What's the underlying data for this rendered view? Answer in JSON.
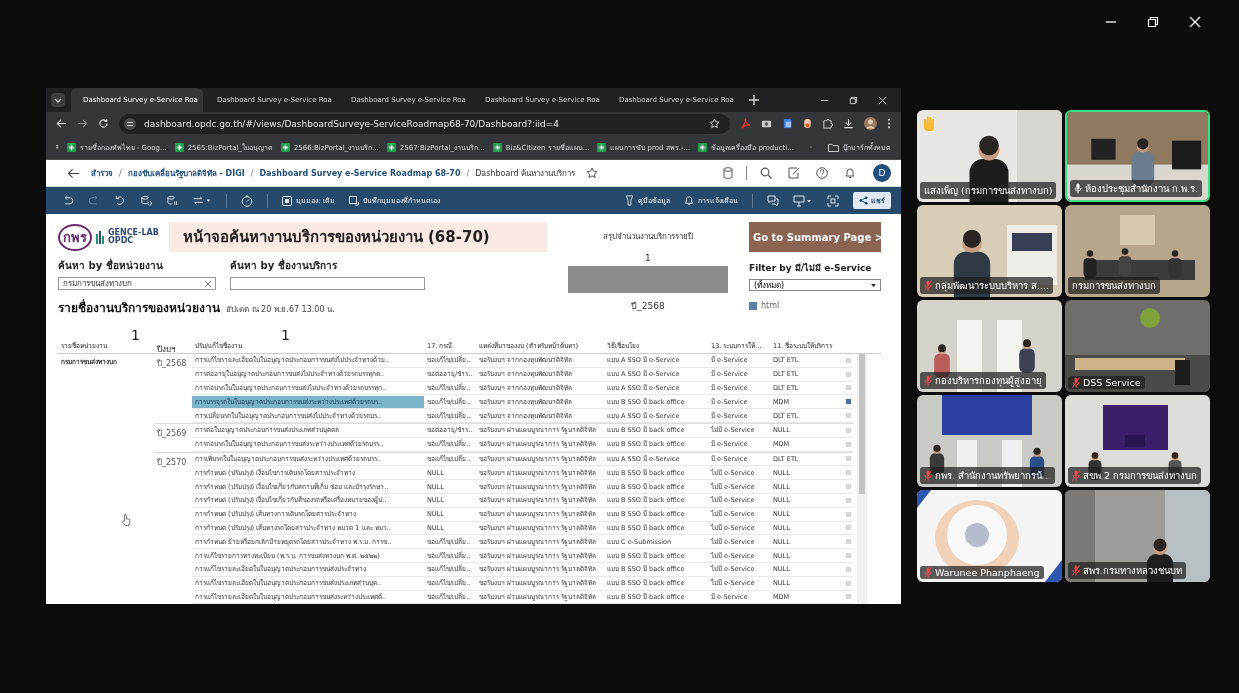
{
  "browser": {
    "tabs": [
      {
        "title": "Dashboard Survey e-Service Roa",
        "selected": true
      },
      {
        "title": "Dashboard Survey e-Service Roa",
        "selected": false
      },
      {
        "title": "Dashboard Survey e-Service Roa",
        "selected": false
      },
      {
        "title": "Dashboard Survey e-Service Roa",
        "selected": false
      },
      {
        "title": "Dashboard Survey e-Service Roa",
        "selected": false
      }
    ],
    "url": "dashboard.opdc.go.th/#/views/DashboardSurveye-ServiceRoadmap68-70/Dashboard?:iid=4",
    "bookmarks": [
      "รายชื่อกองทัพไทย - Goog...",
      "2565:BizPortal_ใบอนุญาต",
      "2566:BizPortal_งานบริก...",
      "2567:BizPortal_งานบริก...",
      "Biz&Citizen รายชื่อแผน...",
      "แผนการขับ prod สพร.-...",
      "ข้อมูลเครื่องมือ producti..."
    ],
    "bookmarks_folder": "บุ๊กมาร์กทั้งหมด"
  },
  "breadcrumb": {
    "separator": "/",
    "items": [
      "สำรวจ",
      "กองขับเคลื่อนรัฐบาลดิจิทัล - DIGI",
      "Dashboard Survey e-Service Roadmap 68-70",
      "Dashboard ค้นหางานบริการ"
    ]
  },
  "user_initial": "D",
  "toolbar": {
    "view": "มุมมอง: เดิม",
    "save_view": "บันทึกมุมมองที่กำหนดเอง",
    "data_guide": "คู่มือข้อมูล",
    "alerts": "การแจ้งเตือน",
    "share": "แชร์"
  },
  "dashboard": {
    "logo_mark": "กพร",
    "logo_lab": "GENCE-LAB",
    "logo_org": "OPDC",
    "title": "หน้าจอค้นหางานบริการของหน่วยงาน (68-70)",
    "agency_search": {
      "label": "ค้นหา by ชื่อหน่วยงาน",
      "value": "กรมการขนส่งทางบก"
    },
    "service_search": {
      "label": "ค้นหา by ชื่องานบริการ"
    },
    "list_title": "รายชื่องานบริการของหน่วยงาน",
    "updated": "อัปเดต ณ 20 พ.ย.67  13.00 น.",
    "summary": {
      "title": "สรุปจำนวนงานบริการรายปี",
      "count": "1",
      "year": "ปี_2568"
    },
    "summary_button": "Go to Summary Page >",
    "filter": {
      "label": "Filter by มี/ไม่มี e-Service",
      "value": "(ทั้งหมด)",
      "legend": [
        "html"
      ]
    },
    "table": {
      "columns": [
        {
          "label": "รายชื่อหน่วยงาน",
          "mark": "1"
        },
        {
          "label": "ปีงบฯ"
        },
        {
          "label": "ปรับ/แก้ไขชื่องาน",
          "mark": "1"
        },
        {
          "label": "17. กรณี"
        },
        {
          "label": "แหล่งที่มาของงบ (สำหรับหน้าค้นหา)"
        },
        {
          "label": "วิธีเชื่อมโยง"
        },
        {
          "label": "13. ระบบการให้..."
        },
        {
          "label": "11. ชื่อระบบให้บริการ"
        }
      ],
      "agencies": [
        {
          "name": "กรมการขนส่งทางบก",
          "years": [
            {
              "year": "ปี_2568",
              "services": [
                {
                  "name": "การแก้ไขรายละเอียดในใบอนุญาตประกอบการขนส่งไม่ประจำทางด้วย..",
                  "case": "ขอแก้ไข/เปลี่ย..",
                  "source": "ขอรับงบฯ จากกองทุนพัฒนาดิจิทัล",
                  "method": "แบบ A SSO มี e-Service",
                  "eservice": "มี e-Service",
                  "system": "DLT ETL",
                  "selected": false
                },
                {
                  "name": "การต่ออายุใบอนุญาตประกอบการขนส่งไม่ประจำทางด้วยรถบรรทุกค..",
                  "case": "ขอต่ออายุ/ชำร..",
                  "source": "ขอรับงบฯ จากกองทุนพัฒนาดิจิทัล",
                  "method": "แบบ A SSO มี e-Service",
                  "eservice": "มี e-Service",
                  "system": "DLT ETL",
                  "selected": false
                },
                {
                  "name": "การถอนรถในใบอนุญาตประกอบการขนส่งไม่ประจำทางด้วยรถบรรทุก..",
                  "case": "ขอแก้ไข/เปลี่ย..",
                  "source": "ขอรับงบฯ จากกองทุนพัฒนาดิจิทัล",
                  "method": "แบบ A SSO มี e-Service",
                  "eservice": "มี e-Service",
                  "system": "DLT ETL",
                  "selected": false
                },
                {
                  "name": "การบรรจุรถในใบอนุญาตประกอบการขนส่งระหว่างประเทศด้วยรถบร..",
                  "case": "ขอแก้ไข/เปลี่ย..",
                  "source": "ขอรับงบฯ จากกองทุนพัฒนาดิจิทัล",
                  "method": "แบบ B SSO มี back office",
                  "eservice": "มี e-Service",
                  "system": "MDM",
                  "selected": true
                },
                {
                  "name": "การเปลี่ยนรถในใบอนุญาตประกอบการขนส่งไม่ประจำทางด้วยรถบร..",
                  "case": "ขอแก้ไข/เปลี่ย..",
                  "source": "ขอรับงบฯ จากกองทุนพัฒนาดิจิทัล",
                  "method": "แบบ A SSO มี e-Service",
                  "eservice": "มี e-Service",
                  "system": "DLT ETL",
                  "selected": false
                }
              ]
            },
            {
              "year": "ปี_2569",
              "services": [
                {
                  "name": "การต่อใบอนุญาตประกอบการขนส่งประเภทส่วนบุคคล",
                  "case": "ขอต่ออายุ/ชำร..",
                  "source": "ขอรับงบฯ ผ่านแผนบูรณาการ รัฐบาลดิจิทัล",
                  "method": "แบบ B SSO มี back office",
                  "eservice": "ไม่มี e-Service",
                  "system": "NULL",
                  "selected": false
                },
                {
                  "name": "การถอนรถในใบอนุญาตประกอบการขนส่งระหว่างประเทศด้วยรถบรร..",
                  "case": "ขอแก้ไข/เปลี่ย..",
                  "source": "ขอรับงบฯ ผ่านแผนบูรณาการ รัฐบาลดิจิทัล",
                  "method": "แบบ B SSO มี back office",
                  "eservice": "มี e-Service",
                  "system": "MDM",
                  "selected": false
                }
              ]
            },
            {
              "year": "ปี_2570",
              "services": [
                {
                  "name": "การเพิ่มรถในใบอนุญาตประกอบการขนส่งระหว่างประเทศด้วยรถบรร..",
                  "case": "ขอแก้ไข/เปลี่ย..",
                  "source": "ขอรับงบฯ ผ่านแผนบูรณาการ รัฐบาลดิจิทัล",
                  "method": "แบบ A SSO มี e-Service",
                  "eservice": "มี e-Service",
                  "system": "DLT ETL",
                  "selected": false
                },
                {
                  "name": "การกำหนด (ปรับปรุง) เงื่อนไขการเดินรถโดยสารประจำทาง",
                  "case": "NULL",
                  "source": "ขอรับงบฯ ผ่านแผนบูรณาการ รัฐบาลดิจิทัล",
                  "method": "แบบ B SSO มี back office",
                  "eservice": "ไม่มี e-Service",
                  "system": "NULL",
                  "selected": false
                },
                {
                  "name": "การกำหนด (ปรับปรุง) เงื่อนไขเกี่ยวกับสถานที่เก็บ ซ่อม และบำรุงรักษา..",
                  "case": "NULL",
                  "source": "ขอรับงบฯ ผ่านแผนบูรณาการ รัฐบาลดิจิทัล",
                  "method": "แบบ B SSO มี back office",
                  "eservice": "ไม่มี e-Service",
                  "system": "NULL",
                  "selected": false
                },
                {
                  "name": "การกำหนด (ปรับปรุง) เงื่อนไขเกี่ยวกับสีของรถหรือเครื่องหมายของผู้ป..",
                  "case": "NULL",
                  "source": "ขอรับงบฯ ผ่านแผนบูรณาการ รัฐบาลดิจิทัล",
                  "method": "แบบ B SSO มี back office",
                  "eservice": "ไม่มี e-Service",
                  "system": "NULL",
                  "selected": false
                },
                {
                  "name": "การกำหนด (ปรับปรุง) เส้นทางการเดินรถโดยสารประจำทาง",
                  "case": "NULL",
                  "source": "ขอรับงบฯ ผ่านแผนบูรณาการ รัฐบาลดิจิทัล",
                  "method": "แบบ B SSO มี back office",
                  "eservice": "ไม่มี e-Service",
                  "system": "NULL",
                  "selected": false
                },
                {
                  "name": "การกำหนด (ปรับปรุง) เส้นทางรถโดยสารประจำทาง หมวด 1 และ หมว..",
                  "case": "NULL",
                  "source": "ขอรับงบฯ ผ่านแผนบูรณาการ รัฐบาลดิจิทัล",
                  "method": "แบบ B SSO มี back office",
                  "eservice": "ไม่มี e-Service",
                  "system": "NULL",
                  "selected": false
                },
                {
                  "name": "การกำหนด ย้ายหรือยกเลิกป้ายหยุดรถโดยสารประจำทาง พ.ร.บ. การข..",
                  "case": "ขอแก้ไข/เปลี่ย..",
                  "source": "ขอรับงบฯ ผ่านแผนบูรณาการ รัฐบาลดิจิทัล",
                  "method": "แบบ C e-Submission",
                  "eservice": "ไม่มี e-Service",
                  "system": "NULL",
                  "selected": false
                },
                {
                  "name": "การแก้ไขรายการทางทะเบียน (พ.ร.บ. การขนส่งทางบก พ.ศ. ๒๕๒๒)",
                  "case": "ขอแก้ไข/เปลี่ย..",
                  "source": "ขอรับงบฯ ผ่านแผนบูรณาการ รัฐบาลดิจิทัล",
                  "method": "แบบ B SSO มี back office",
                  "eservice": "ไม่มี e-Service",
                  "system": "NULL",
                  "selected": false
                },
                {
                  "name": "การแก้ไขรายละเอียดในใบอนุญาตประกอบการขนส่งประจำทาง",
                  "case": "ขอแก้ไข/เปลี่ย..",
                  "source": "ขอรับงบฯ ผ่านแผนบูรณาการ รัฐบาลดิจิทัล",
                  "method": "แบบ B SSO มี back office",
                  "eservice": "ไม่มี e-Service",
                  "system": "NULL",
                  "selected": false
                },
                {
                  "name": "การแก้ไขรายละเอียดในใบอนุญาตประกอบการขนส่งประเภทส่วนบุค..",
                  "case": "ขอแก้ไข/เปลี่ย..",
                  "source": "ขอรับงบฯ ผ่านแผนบูรณาการ รัฐบาลดิจิทัล",
                  "method": "แบบ B SSO มี back office",
                  "eservice": "ไม่มี e-Service",
                  "system": "NULL",
                  "selected": false
                },
                {
                  "name": "การแก้ไขรายละเอียดในใบอนุญาตประกอบการขนส่งระหว่างประเทศด้..",
                  "case": "ขอแก้ไข/เปลี่ย..",
                  "source": "ขอรับงบฯ ผ่านแผนบูรณาการ รัฐบาลดิจิทัล",
                  "method": "แบบ B SSO มี back office",
                  "eservice": "มี e-Service",
                  "system": "MDM",
                  "selected": false
                }
              ]
            }
          ]
        }
      ]
    }
  },
  "participants": [
    {
      "name": "แสงเพ็ญ (กรมการขนส่งทางบก)",
      "muted": false,
      "speaking": false,
      "hand_raised": true
    },
    {
      "name": "ห้องประชุมสำนักงาน ก.พ.ร.",
      "muted": false,
      "speaking": true,
      "hand_raised": false
    },
    {
      "name": "กลุ่มพัฒนาระบบบริหาร ส....",
      "muted": true,
      "speaking": false,
      "hand_raised": false
    },
    {
      "name": "กรมการขนส่งทางบก",
      "muted": false,
      "speaking": false,
      "hand_raised": false
    },
    {
      "name": "กองบริหารกองทุนผู้สูงอายุ",
      "muted": true,
      "speaking": false,
      "hand_raised": false
    },
    {
      "name": "DSS Service",
      "muted": true,
      "speaking": false,
      "hand_raised": false
    },
    {
      "name": "กพร. สำนักงานทรัพยากรน้...",
      "muted": true,
      "speaking": false,
      "hand_raised": false
    },
    {
      "name": "สขพ.2 กรมการขนส่งทางบก",
      "muted": true,
      "speaking": false,
      "hand_raised": false
    },
    {
      "name": "Warunee Phanphaeng",
      "muted": true,
      "speaking": false,
      "hand_raised": false
    },
    {
      "name": "สพร.กรมทางหลวงชนบท",
      "muted": true,
      "speaking": false,
      "hand_raised": false
    }
  ]
}
